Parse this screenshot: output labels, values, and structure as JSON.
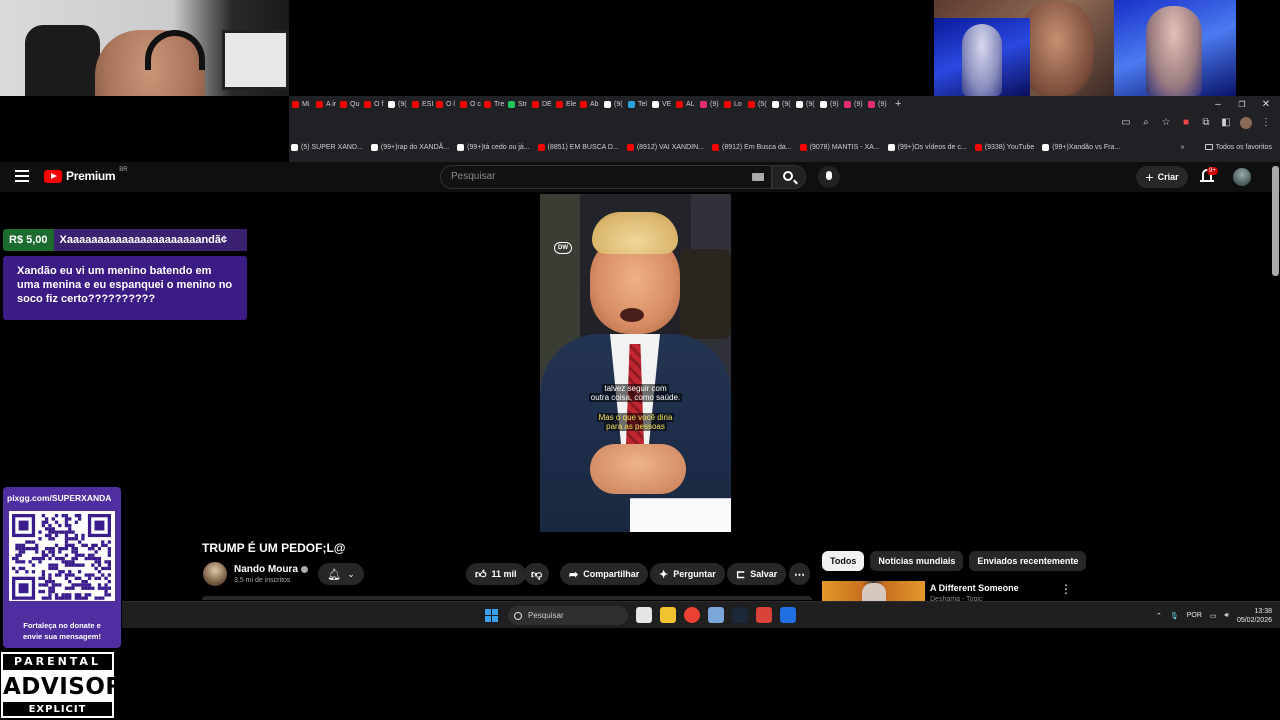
{
  "browser": {
    "tabs": [
      {
        "label": "Mi",
        "color": "#ff0000"
      },
      {
        "label": "A ir",
        "color": "#ff0000"
      },
      {
        "label": "Qu",
        "color": "#ff0000"
      },
      {
        "label": "O f",
        "color": "#ff0000"
      },
      {
        "label": "(9(",
        "color": "#ffffff"
      },
      {
        "label": "ESI",
        "color": "#ff0000"
      },
      {
        "label": "O l",
        "color": "#ff0000"
      },
      {
        "label": "O c",
        "color": "#ff0000"
      },
      {
        "label": "Tre",
        "color": "#ff0000"
      },
      {
        "label": "Str",
        "color": "#22c55e"
      },
      {
        "label": "DE",
        "color": "#ff0000"
      },
      {
        "label": "Ele",
        "color": "#ff0000"
      },
      {
        "label": "Ab",
        "color": "#ff0000"
      },
      {
        "label": "(9(",
        "color": "#ffffff"
      },
      {
        "label": "Tel",
        "color": "#2aa3e0"
      },
      {
        "label": "VE",
        "color": "#ffffff"
      },
      {
        "label": "AL",
        "color": "#ff0000"
      },
      {
        "label": "(9)",
        "color": "#e1306c"
      },
      {
        "label": "Lo",
        "color": "#ff0000"
      },
      {
        "label": "(5(",
        "color": "#ff0000"
      },
      {
        "label": "(9(",
        "color": "#ffffff"
      },
      {
        "label": "(9(",
        "color": "#ffffff"
      },
      {
        "label": "(9)",
        "color": "#ffffff"
      },
      {
        "label": "(9)",
        "color": "#e1306c"
      },
      {
        "label": "(9)",
        "color": "#e1306c"
      }
    ],
    "new_tab": "+",
    "window_controls": {
      "minimize": "–",
      "restore": "❐",
      "close": "✕"
    },
    "bookmarks": [
      {
        "label": "(5) SUPER XAND...",
        "color": "#ffffff"
      },
      {
        "label": "(99+)rap do XANDÃ...",
        "color": "#ffffff"
      },
      {
        "label": "(99+)tá cedo ou já...",
        "color": "#ffffff"
      },
      {
        "label": "(8851) EM BUSCA D...",
        "color": "#ff0000"
      },
      {
        "label": "(8912) VAI XANDIN...",
        "color": "#ff0000"
      },
      {
        "label": "(8912) Em Busca da...",
        "color": "#ff0000"
      },
      {
        "label": "(9078) MANTIS - XA...",
        "color": "#ff0000"
      },
      {
        "label": "(99+)Os vídeos de c...",
        "color": "#ffffff"
      },
      {
        "label": "(9338) YouTube",
        "color": "#ff0000"
      },
      {
        "label": "(99+)Xandão vs Fra...",
        "color": "#ffffff"
      }
    ],
    "bookmarks_more": "»",
    "all_bookmarks": "Todos os favoritos"
  },
  "youtube": {
    "logo": "Premium",
    "logo_region": "BR",
    "search_placeholder": "Pesquisar",
    "create_label": "Criar",
    "notifications_badge": "9+"
  },
  "video": {
    "caption_line1": "talvez seguir com",
    "caption_line2": "outra coisa, como saúde.",
    "caption_line3": "Mas o que você diria",
    "caption_line4": "para as pessoas",
    "watermark": "DW",
    "title": "TRUMP É UM PEDOF;L@",
    "channel": "Nando Moura",
    "subscribers": "3,5 mi de inscritos",
    "likes": "11 mil",
    "share_label": "Compartilhar",
    "ask_label": "Perguntar",
    "save_label": "Salvar"
  },
  "sidebar": {
    "chips": [
      "Todos",
      "Notícias mundiais",
      "Enviados recentemente"
    ],
    "rec_title": "A Different Someone",
    "rec_channel": "Deshama - Topic"
  },
  "taskbar": {
    "search_placeholder": "Pesquisar",
    "language": "POR",
    "time": "13:38",
    "date": "05/02/2026",
    "apps": [
      {
        "name": "task-view",
        "color": "#e6e6e6"
      },
      {
        "name": "file-explorer",
        "color": "#f2c230"
      },
      {
        "name": "chrome",
        "color": "#e94235"
      },
      {
        "name": "settings",
        "color": "#7aa7d8"
      },
      {
        "name": "steam",
        "color": "#1b2838"
      },
      {
        "name": "app-red",
        "color": "#d9443a"
      },
      {
        "name": "app-blue",
        "color": "#1f6fe0"
      }
    ]
  },
  "donation": {
    "amount": "R$ 5,00",
    "name": "Xaaaaaaaaaaaaaaaaaaaaaandã¢",
    "message": "Xandão eu vi um menino batendo em uma menina e eu espanquei o menino no soco fiz certo??????????"
  },
  "qr": {
    "url": "pixgg.com/SUPERXANDA",
    "note_line1": "Fortaleça no donate e",
    "note_line2": "envie sua mensagem!"
  },
  "parental_advisory": {
    "top": "PARENTAL",
    "middle": "ADVISORY",
    "bottom": "EXPLICIT CONTENT"
  }
}
